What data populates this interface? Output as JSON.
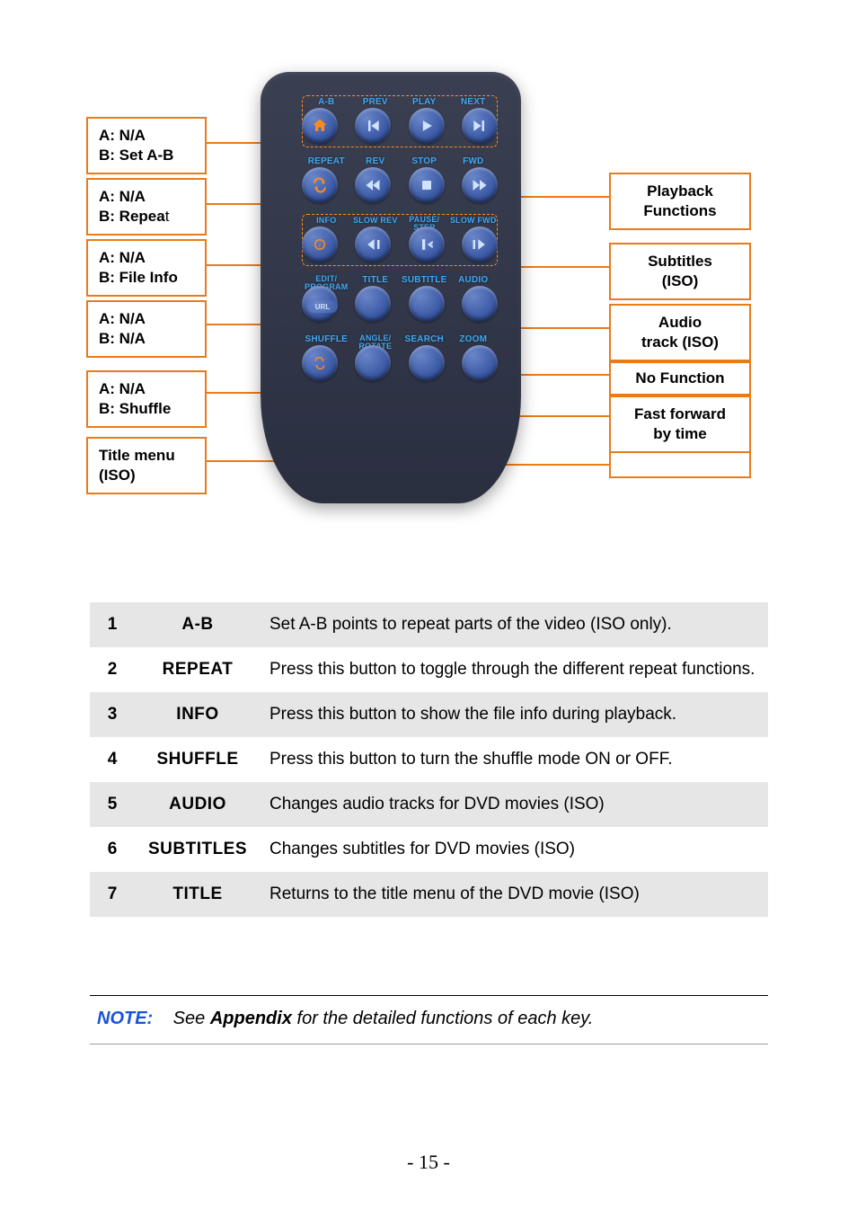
{
  "callouts_left": [
    {
      "lineA": "A: N/A",
      "lineB": "B: Set A-B"
    },
    {
      "lineA": "A: N/A",
      "lineB_prefix": "B: Repea",
      "lineB_suffix": "t"
    },
    {
      "lineA": "A: N/A",
      "lineB": "B: File Info"
    },
    {
      "lineA": "A: N/A",
      "lineB": "B: N/A"
    },
    {
      "lineA": "A: N/A",
      "lineB": "B: Shuffle"
    },
    {
      "lineA": "Title menu",
      "lineB": "(ISO)"
    }
  ],
  "callouts_right": [
    {
      "lineA": "Playback",
      "lineB": "Functions"
    },
    {
      "lineA": "Subtitles",
      "lineB": "(ISO)"
    },
    {
      "lineA": "Audio",
      "lineB": "track (ISO)"
    },
    {
      "lineA": "No Function",
      "lineB": ""
    },
    {
      "lineA": "Fast forward",
      "lineB": "by time"
    },
    {
      "lineA": "",
      "lineB": ""
    }
  ],
  "remote_rows": [
    {
      "labels": [
        "A-B",
        "PREV",
        "PLAY",
        "NEXT"
      ]
    },
    {
      "labels": [
        "REPEAT",
        "REV",
        "STOP",
        "FWD"
      ]
    },
    {
      "labels": [
        "INFO",
        "SLOW REV",
        "PAUSE/\nSTEP",
        "SLOW FWD"
      ]
    },
    {
      "labels": [
        "EDIT/\nPROGRAM",
        "TITLE",
        "SUBTITLE",
        "AUDIO"
      ]
    },
    {
      "labels": [
        "URL",
        "",
        "",
        ""
      ]
    },
    {
      "labels": [
        "SHUFFLE",
        "ANGLE/\nROTATE",
        "SEARCH",
        "ZOOM"
      ]
    },
    {
      "labels": [
        "",
        "",
        "",
        ""
      ]
    }
  ],
  "table": [
    {
      "n": "1",
      "key": "A-B",
      "desc": "Set A-B points to repeat parts of the video (ISO only)."
    },
    {
      "n": "2",
      "key": "REPEAT",
      "desc": "Press this button to toggle through the different repeat functions."
    },
    {
      "n": "3",
      "key": "INFO",
      "desc": "Press this button to show the file info during playback."
    },
    {
      "n": "4",
      "key": "SHUFFLE",
      "desc": "Press this button to turn the shuffle mode ON or OFF."
    },
    {
      "n": "5",
      "key": "AUDIO",
      "desc": "Changes audio tracks for DVD movies (ISO)"
    },
    {
      "n": "6",
      "key": "SUBTITLES",
      "desc": "Changes subtitles for DVD movies (ISO)"
    },
    {
      "n": "7",
      "key": "TITLE",
      "desc": "Returns to the title menu of the DVD movie (ISO)"
    }
  ],
  "note": {
    "label": "NOTE:",
    "prefix": "See ",
    "bold": "Appendix",
    "suffix": " for the detailed functions of each key."
  },
  "page_number": "- 15 -"
}
